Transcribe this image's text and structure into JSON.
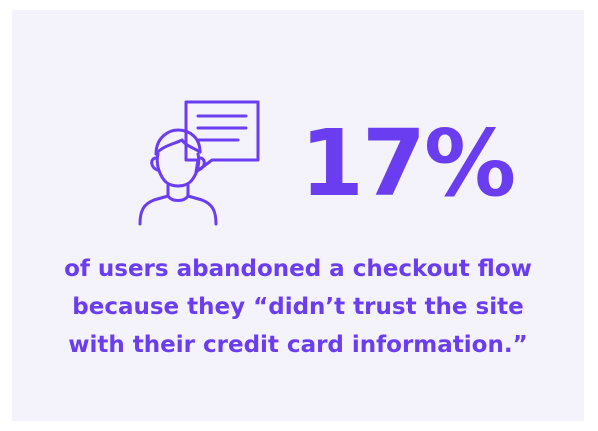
{
  "stat": {
    "value": "17%"
  },
  "caption": {
    "lines": [
      "of users abandoned a checkout flow",
      "because they “didn’t trust the site",
      "with their credit card information.”"
    ]
  },
  "icon": {
    "name": "user-speech-bubble-icon"
  },
  "colors": {
    "accent": "#6a3df0",
    "card_background": "#f4f2fb",
    "page_background": "#ffffff"
  }
}
